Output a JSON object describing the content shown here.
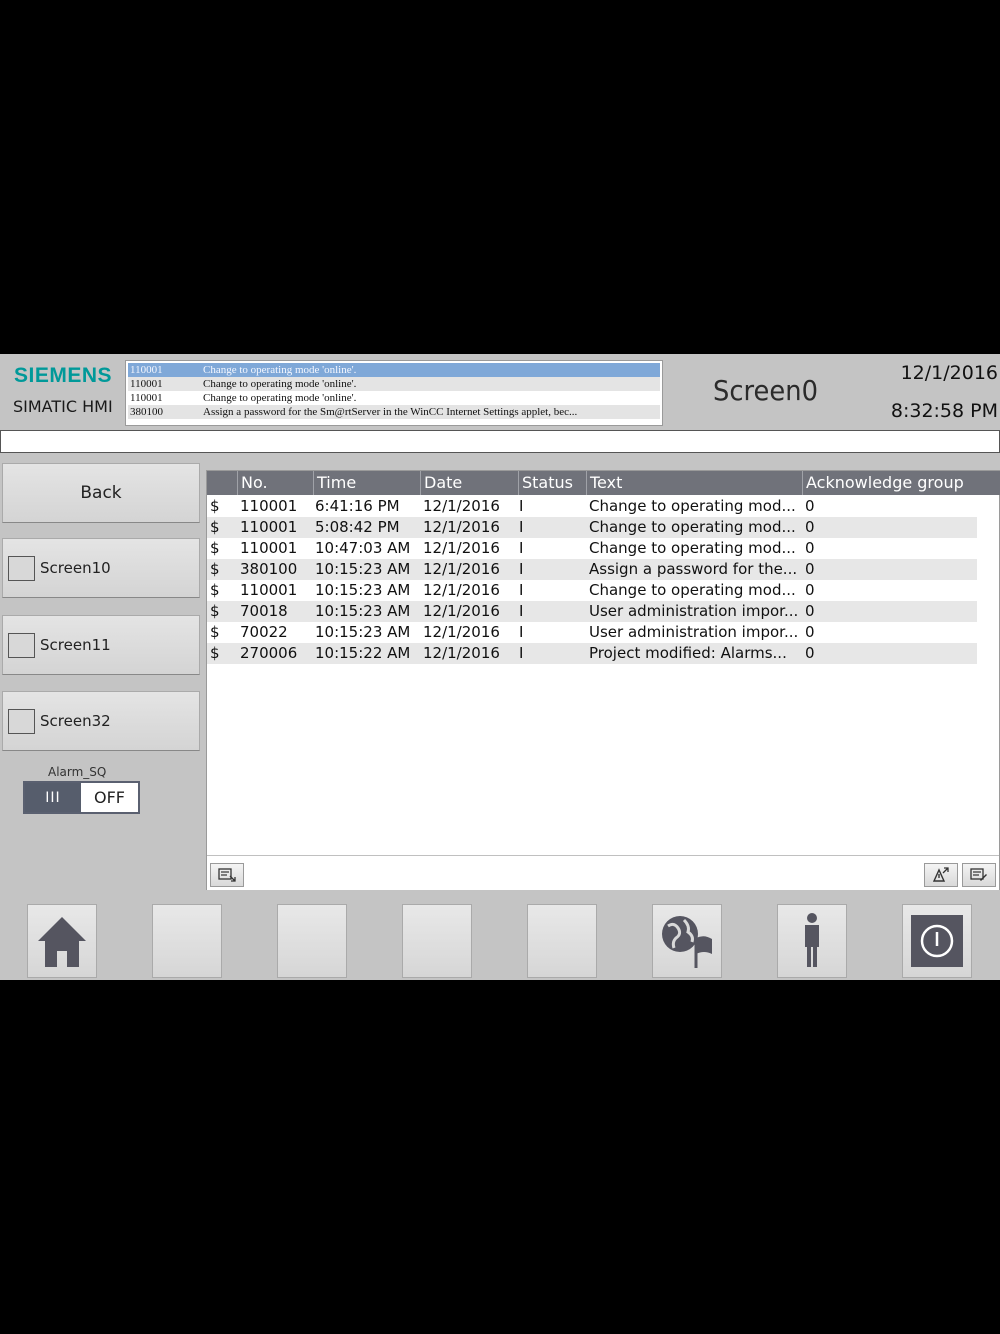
{
  "header": {
    "logo": "SIEMENS",
    "product": "SIMATIC HMI",
    "screen_title": "Screen0",
    "date": "12/1/2016",
    "time": "8:32:58 PM"
  },
  "alarm_ticker": [
    {
      "number": "110001",
      "text": "Change to operating mode 'online'."
    },
    {
      "number": "110001",
      "text": "Change to operating mode 'online'."
    },
    {
      "number": "110001",
      "text": "Change to operating mode 'online'."
    },
    {
      "number": "380100",
      "text": "Assign a password for the Sm@rtServer in the WinCC Internet Settings applet, bec..."
    }
  ],
  "nav": {
    "back_label": "Back",
    "items": [
      {
        "label": "Screen10"
      },
      {
        "label": "Screen11"
      },
      {
        "label": "Screen32"
      }
    ]
  },
  "alarm_sq": {
    "label": "Alarm_SQ",
    "handle": "III",
    "state": "OFF"
  },
  "alarm_table": {
    "columns": [
      "No.",
      "Time",
      "Date",
      "Status",
      "Text",
      "Acknowledge group"
    ],
    "rows": [
      {
        "icon": "$",
        "no": "110001",
        "time": "6:41:16 PM",
        "date": "12/1/2016",
        "status": "I",
        "text": "Change to operating mod...",
        "ack": "0"
      },
      {
        "icon": "$",
        "no": "110001",
        "time": "5:08:42 PM",
        "date": "12/1/2016",
        "status": "I",
        "text": "Change to operating mod...",
        "ack": "0"
      },
      {
        "icon": "$",
        "no": "110001",
        "time": "10:47:03 AM",
        "date": "12/1/2016",
        "status": "I",
        "text": "Change to operating mod...",
        "ack": "0"
      },
      {
        "icon": "$",
        "no": "380100",
        "time": "10:15:23 AM",
        "date": "12/1/2016",
        "status": "I",
        "text": "Assign a password for the...",
        "ack": "0"
      },
      {
        "icon": "$",
        "no": "110001",
        "time": "10:15:23 AM",
        "date": "12/1/2016",
        "status": "I",
        "text": "Change to operating mod...",
        "ack": "0"
      },
      {
        "icon": "$",
        "no": "70018",
        "time": "10:15:23 AM",
        "date": "12/1/2016",
        "status": "I",
        "text": "User administration impor...",
        "ack": "0"
      },
      {
        "icon": "$",
        "no": "70022",
        "time": "10:15:23 AM",
        "date": "12/1/2016",
        "status": "I",
        "text": "User administration impor...",
        "ack": "0"
      },
      {
        "icon": "$",
        "no": "270006",
        "time": "10:15:22 AM",
        "date": "12/1/2016",
        "status": "I",
        "text": "Project modified: Alarms...",
        "ack": "0"
      }
    ]
  },
  "function_keys": [
    "home-icon",
    "",
    "",
    "",
    "",
    "language-globe-icon",
    "user-icon",
    "power-icon"
  ],
  "colors": {
    "brand": "#009999",
    "panel": "#c4c4c4",
    "table_header": "#70727a",
    "ticker_highlight": "#7fa8d8",
    "icon_dark": "#555560"
  }
}
